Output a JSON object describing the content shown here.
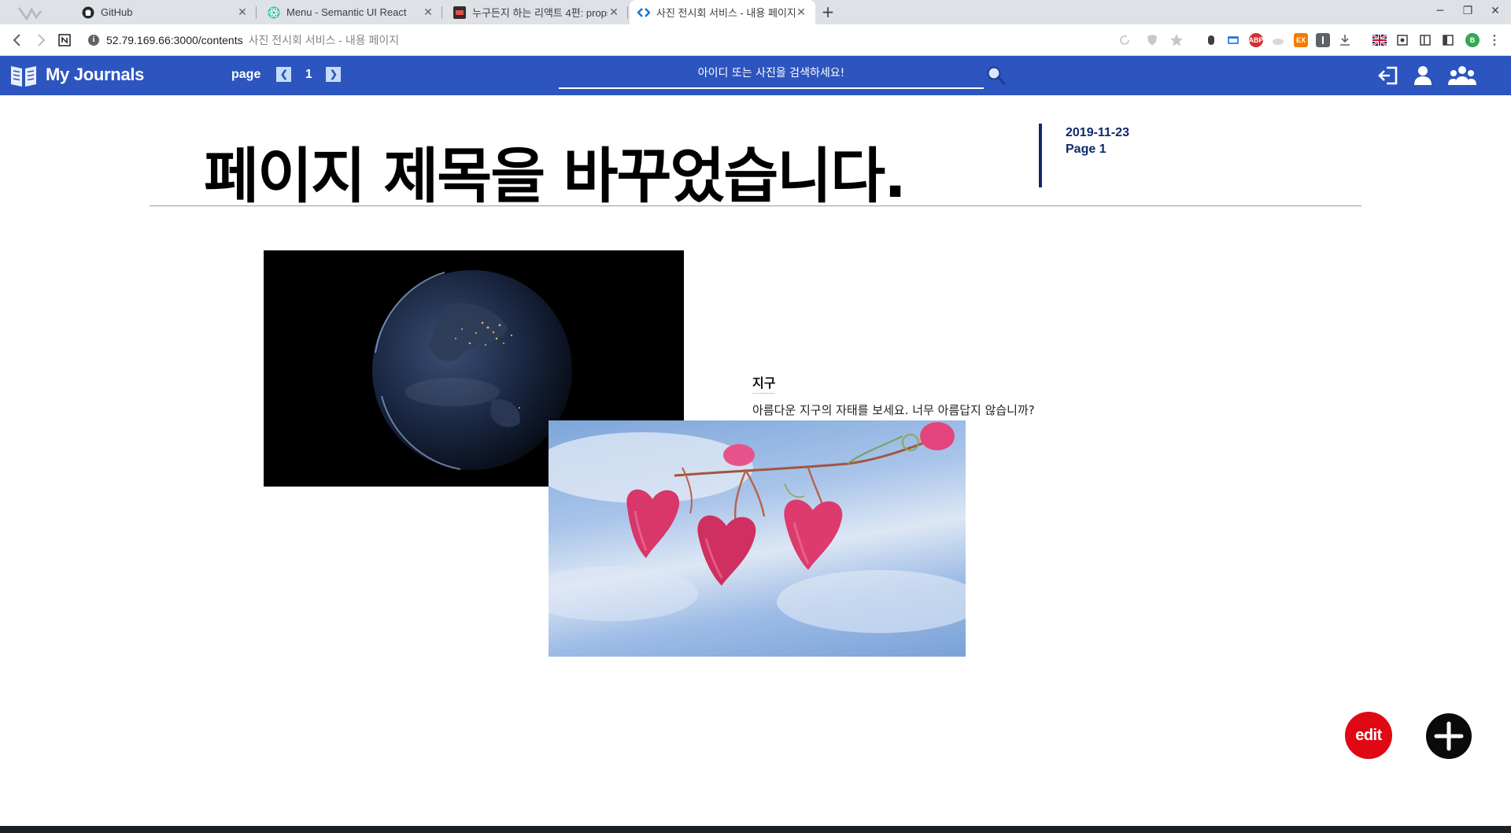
{
  "browser": {
    "tabs": [
      {
        "title": "GitHub",
        "active": false
      },
      {
        "title": "Menu - Semantic UI React",
        "active": false
      },
      {
        "title": "누구든지 하는 리액트 4편: props",
        "active": false
      },
      {
        "title": "사진 전시회 서비스 - 내용 페이지",
        "active": true
      }
    ],
    "new_tab_label": "+",
    "url_host": "52.79.169.66:3000/contents",
    "url_page_title": "사진 전시회 서비스 - 내용 페이지",
    "extensions": [
      "puzzle-icon",
      "star-icon",
      "abp-badge",
      "ex-badge",
      "download-icon",
      "uk-flag-icon",
      "profile-avatar"
    ],
    "profile_initial": "B",
    "abp_label": "ABP",
    "ex_label": "EX"
  },
  "app": {
    "brand": "My Journals",
    "pager_label": "page",
    "page_number": "1",
    "search_placeholder": "아이디 또는 사진을 검색하세요!",
    "accent": "#2d55bf"
  },
  "page": {
    "title": "페이지 제목을 바꾸었습니다.",
    "date": "2019-11-23",
    "page_label": "Page 1"
  },
  "card": {
    "title": "지구",
    "description": "아름다운 지구의 자태를 보세요. 너무 아름답지 않습니까?"
  },
  "fab": {
    "edit_label": "edit",
    "edit_color": "#e00812"
  }
}
